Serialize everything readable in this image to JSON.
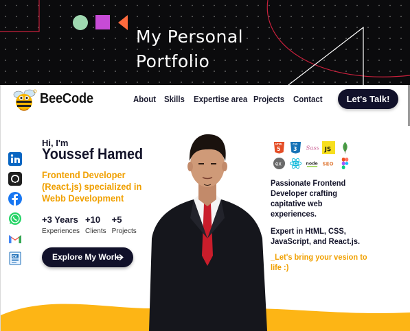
{
  "banner": {
    "title": "My Personal Portfolio",
    "colors": {
      "background": "#0b0b0d",
      "circle": "#9fd8b0",
      "square": "#c74bd6",
      "triangle": "#ff6a3d",
      "lines": "#c8203c"
    }
  },
  "nav": {
    "brand": "BeeCode",
    "links": [
      "About",
      "Skills",
      "Expertise area",
      "Projects",
      "Contact"
    ],
    "cta_label": "Let's Talk!"
  },
  "socials": [
    "linkedin-icon",
    "github-icon",
    "facebook-icon",
    "whatsapp-icon",
    "gmail-icon",
    "cv-icon"
  ],
  "hero": {
    "greeting": "Hi, I'm",
    "name": "Youssef Hamed",
    "role": "Frontend Developer (React.js) specialized in Webb Development",
    "stats": [
      {
        "num": "+3 Years",
        "label": "Experiences"
      },
      {
        "num": "+10",
        "label": "Clients"
      },
      {
        "num": "+5",
        "label": "Projects"
      }
    ],
    "button_label": "Explore My Work"
  },
  "tech": {
    "row1": [
      "HTML",
      "CSS",
      "Sass",
      "JS",
      "MongoDB"
    ],
    "row1_labels": [
      "HTML",
      "CSS",
      "",
      "JS",
      ""
    ],
    "row2": [
      "Express",
      "React",
      "Node",
      "SEO",
      "Figma"
    ],
    "row2_labels": [
      "ex",
      "",
      "node",
      "SEO",
      ""
    ]
  },
  "about": {
    "text": "Passionate Frontend Developer crafting capitative web experiences.",
    "expert": "Expert in HtML, CSS, JavaScript, and React.js.",
    "cta": "_Let's bring your vesion to life :)"
  },
  "colors": {
    "accent": "#f0a000",
    "dark": "#11112a",
    "wave": "#fdb515"
  }
}
